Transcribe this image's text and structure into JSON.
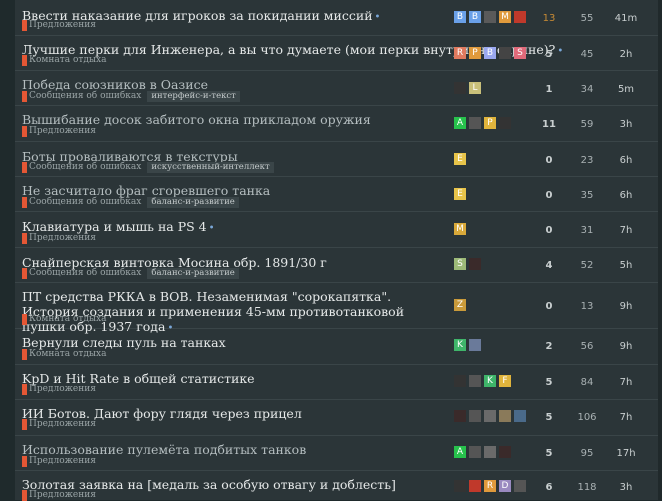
{
  "colors": {
    "category_suggestions": "#e45735",
    "category_offtopic": "#e45735",
    "category_bugs": "#e45735"
  },
  "topics": [
    {
      "title": "Ввести наказание для игроков за покидании миссий",
      "category": "Предложения",
      "tag": "",
      "replies": "13",
      "views": "55",
      "activity": "41m",
      "avatars": [
        {
          "l": "B",
          "c": "#6aa0e8"
        },
        {
          "l": "B",
          "c": "#6aa0e8"
        },
        {
          "l": "",
          "c": "#5a5a5a"
        },
        {
          "l": "M",
          "c": "#e09a3c"
        },
        {
          "l": "",
          "c": "#c0392b"
        }
      ]
    },
    {
      "title": "Лучшие перки для Инженера, а вы что думаете (мои перки внутри, на скрине)?",
      "category": "Комната отдыха",
      "tag": "",
      "replies": "5",
      "views": "45",
      "activity": "2h",
      "avatars": [
        {
          "l": "R",
          "c": "#e07a5f"
        },
        {
          "l": "P",
          "c": "#e09a3c"
        },
        {
          "l": "B",
          "c": "#9aa8f0"
        },
        {
          "l": "",
          "c": "#444"
        },
        {
          "l": "S",
          "c": "#e06a7a"
        }
      ]
    },
    {
      "title": "Победа союзников в Оазисе",
      "category": "Сообщения об ошибках",
      "tag": "интерфейс-и-текст",
      "replies": "1",
      "views": "34",
      "activity": "5m",
      "avatars": [
        {
          "l": "",
          "c": "#333"
        },
        {
          "l": "L",
          "c": "#c9c07a"
        }
      ]
    },
    {
      "title": "Выши­бание досок забитого окна прикладом оружия",
      "category": "Предложения",
      "tag": "",
      "replies": "11",
      "views": "59",
      "activity": "3h",
      "avatars": [
        {
          "l": "A",
          "c": "#27c24c"
        },
        {
          "l": "",
          "c": "#555"
        },
        {
          "l": "P",
          "c": "#e0b43c"
        },
        {
          "l": "",
          "c": "#333"
        }
      ]
    },
    {
      "title": "Боты проваливаются в текстуры",
      "category": "Сообщения об ошибках",
      "tag": "искусственный-интеллект",
      "replies": "0",
      "views": "23",
      "activity": "6h",
      "avatars": [
        {
          "l": "E",
          "c": "#e8c44a"
        }
      ]
    },
    {
      "title": "Не засчитало фраг сгоревшего танка",
      "category": "Сообщения об ошибках",
      "tag": "баланс-и-развитие",
      "replies": "0",
      "views": "35",
      "activity": "6h",
      "avatars": [
        {
          "l": "E",
          "c": "#e8c44a"
        }
      ]
    },
    {
      "title": "Клавиатура и мышь на PS 4",
      "category": "Предложения",
      "tag": "",
      "replies": "0",
      "views": "31",
      "activity": "7h",
      "avatars": [
        {
          "l": "M",
          "c": "#d9a93a"
        }
      ]
    },
    {
      "title": "Снайперская винтовка Мосина обр. 1891/30 г",
      "category": "Сообщения об ошибках",
      "tag": "баланс-и-развитие",
      "replies": "4",
      "views": "52",
      "activity": "5h",
      "avatars": [
        {
          "l": "S",
          "c": "#9dba78"
        },
        {
          "l": "",
          "c": "#3a2a2a"
        }
      ]
    },
    {
      "title": "ПТ средства РККА в ВОВ. Незаменимая \"сорокапятка\". История создания и применения 45-мм противотанковой пушки обр. 1937 года",
      "category": "Комната отдыха",
      "tag": "",
      "replies": "0",
      "views": "13",
      "activity": "9h",
      "avatars": [
        {
          "l": "Z",
          "c": "#c99a3a"
        }
      ]
    },
    {
      "title": "Вернули следы пуль на танках",
      "category": "Комната отдыха",
      "tag": "",
      "replies": "2",
      "views": "56",
      "activity": "9h",
      "avatars": [
        {
          "l": "K",
          "c": "#3fb56a"
        },
        {
          "l": "",
          "c": "#6a7a9a"
        }
      ]
    },
    {
      "title": "KpD и Hit Rate в общей статистике",
      "category": "Предложения",
      "tag": "",
      "replies": "5",
      "views": "84",
      "activity": "7h",
      "avatars": [
        {
          "l": "",
          "c": "#333"
        },
        {
          "l": "",
          "c": "#555"
        },
        {
          "l": "K",
          "c": "#3fb56a"
        },
        {
          "l": "F",
          "c": "#e0b43c"
        }
      ]
    },
    {
      "title": "ИИ Ботов. Дают фору глядя через прицел",
      "category": "Предложения",
      "tag": "",
      "replies": "5",
      "views": "106",
      "activity": "7h",
      "avatars": [
        {
          "l": "",
          "c": "#3a2a2a"
        },
        {
          "l": "",
          "c": "#555"
        },
        {
          "l": "",
          "c": "#6a6a6a"
        },
        {
          "l": "",
          "c": "#8a7a5a"
        },
        {
          "l": "",
          "c": "#4a6a8a"
        }
      ]
    },
    {
      "title": "Использование пулемёта подбитых танков",
      "category": "Предложения",
      "tag": "",
      "replies": "5",
      "views": "95",
      "activity": "17h",
      "avatars": [
        {
          "l": "A",
          "c": "#27c24c"
        },
        {
          "l": "",
          "c": "#555"
        },
        {
          "l": "",
          "c": "#6a6a6a"
        },
        {
          "l": "",
          "c": "#3a2a2a"
        }
      ]
    },
    {
      "title": "Золотая заявка на [медаль за особую отвагу и доблесть]",
      "category": "Предложения",
      "tag": "",
      "replies": "6",
      "views": "118",
      "activity": "3h",
      "avatars": [
        {
          "l": "",
          "c": "#333"
        },
        {
          "l": "",
          "c": "#c0392b"
        },
        {
          "l": "R",
          "c": "#e09a3c"
        },
        {
          "l": "D",
          "c": "#9a8ac0"
        },
        {
          "l": "",
          "c": "#555"
        }
      ]
    }
  ]
}
